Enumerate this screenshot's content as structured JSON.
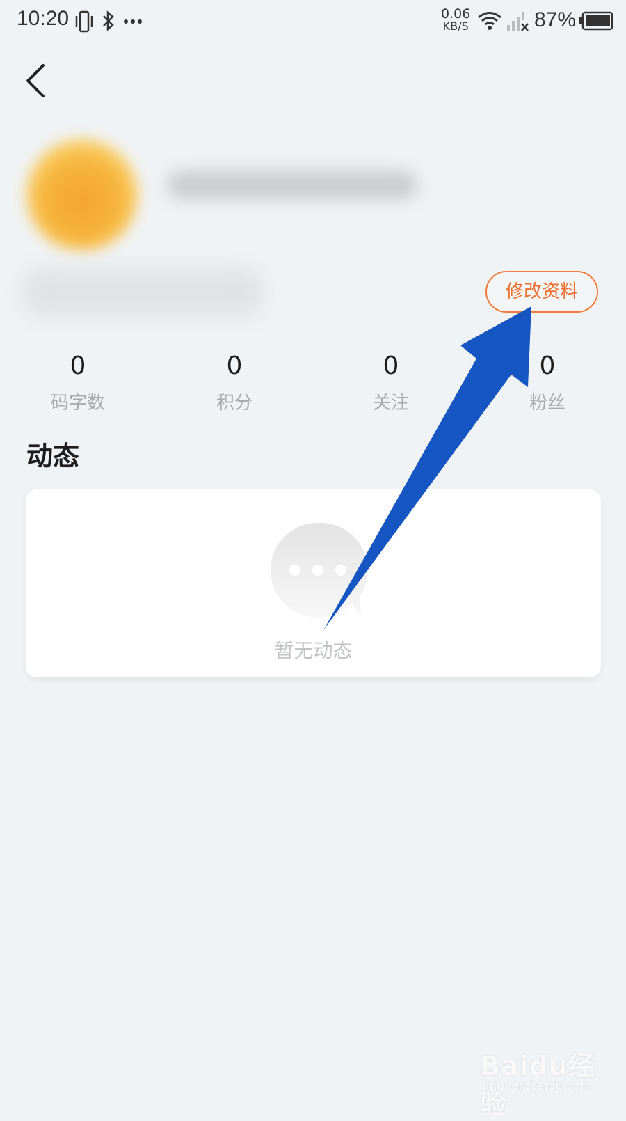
{
  "status_bar": {
    "time": "10:20",
    "net_speed_value": "0.06",
    "net_speed_unit": "KB/S",
    "battery": "87%"
  },
  "profile": {
    "edit_button": "修改资料"
  },
  "stats": [
    {
      "value": "0",
      "label": "码字数"
    },
    {
      "value": "0",
      "label": "积分"
    },
    {
      "value": "0",
      "label": "关注"
    },
    {
      "value": "0",
      "label": "粉丝"
    }
  ],
  "feed": {
    "title": "动态",
    "empty_text": "暂无动态"
  },
  "annotation": {
    "arrow_color": "#1656c2"
  },
  "watermark": {
    "main": "Baidu经验",
    "sub": "jingyan.baidu.com"
  },
  "colors": {
    "accent": "#ec7030",
    "background": "#f0f3f5"
  }
}
